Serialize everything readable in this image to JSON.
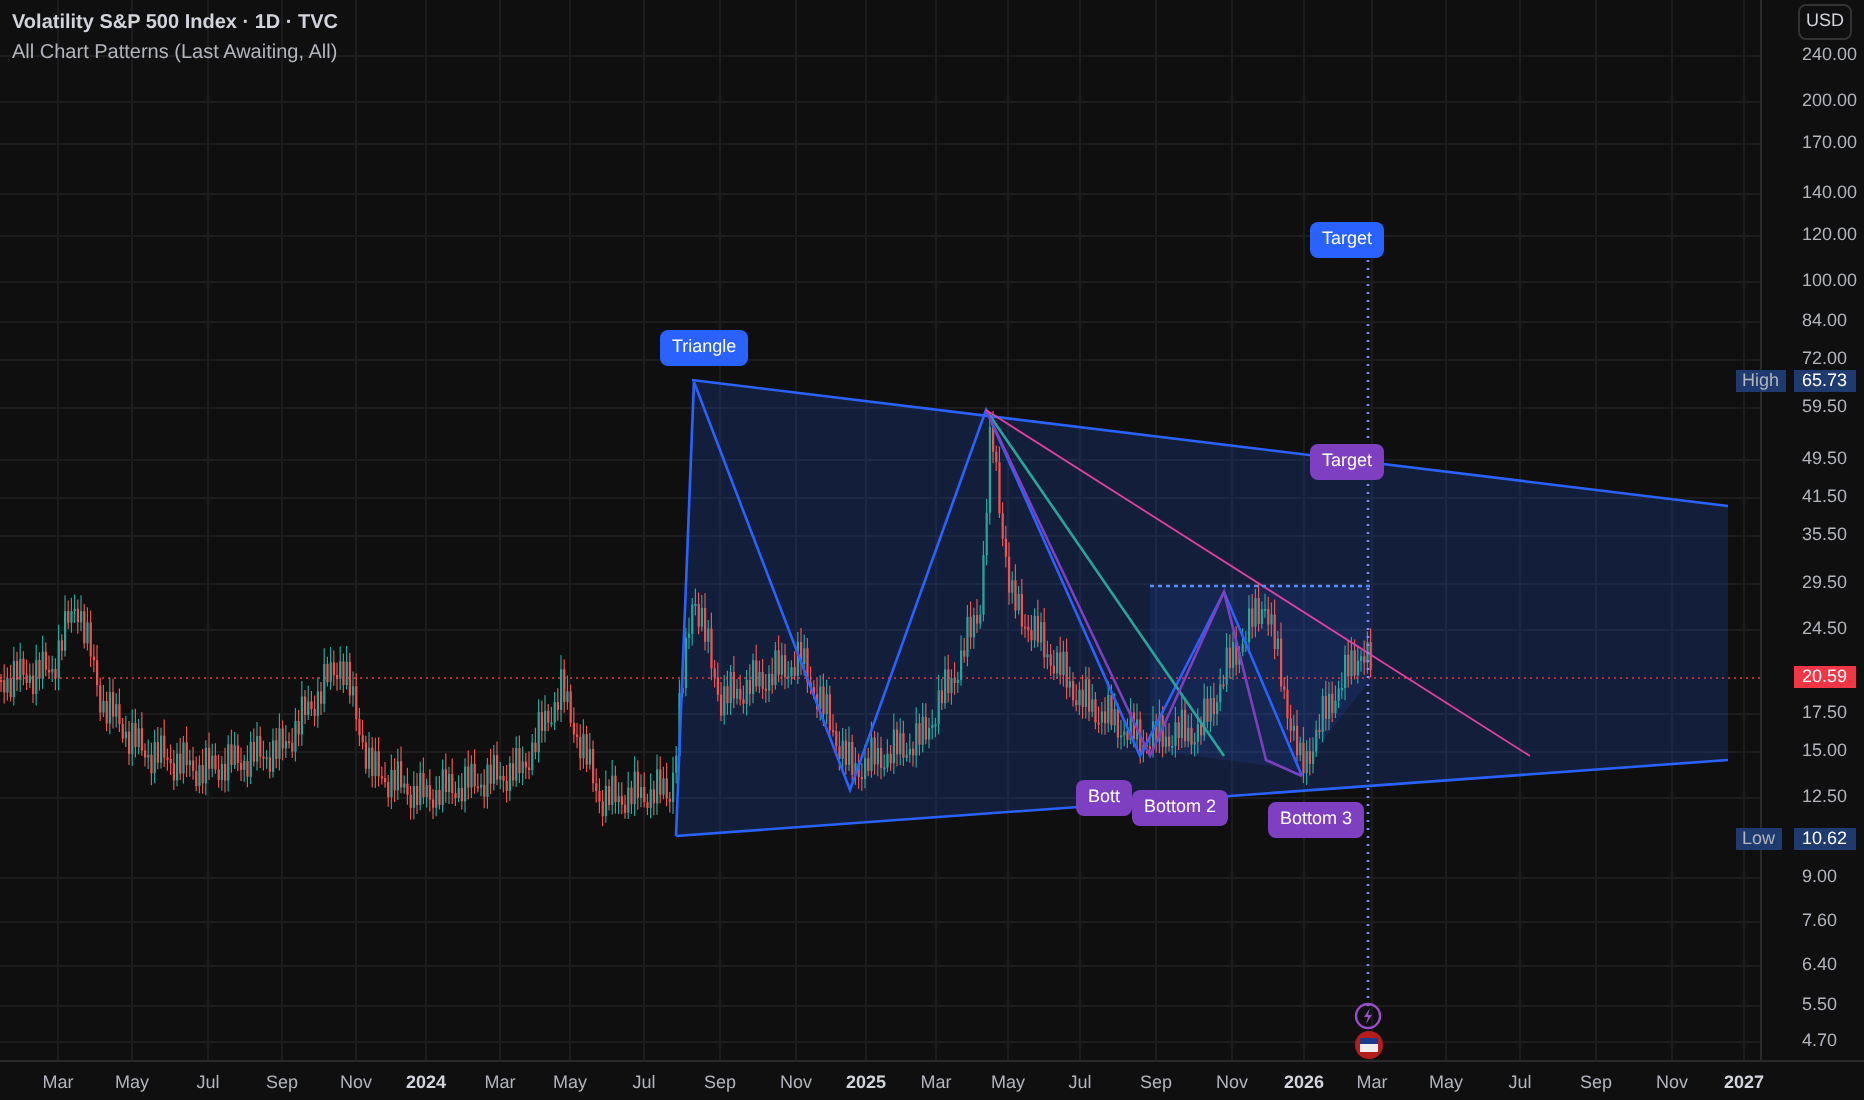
{
  "header": {
    "title": "Volatility S&P 500 Index · 1D · TVC",
    "subtitle": "All Chart Patterns (Last Awaiting, All)"
  },
  "price_axis": {
    "currency": "USD",
    "ticks": [
      "240.00",
      "200.00",
      "170.00",
      "140.00",
      "120.00",
      "100.00",
      "84.00",
      "72.00",
      "59.50",
      "49.50",
      "41.50",
      "35.50",
      "29.50",
      "24.50",
      "17.50",
      "15.00",
      "12.50",
      "9.00",
      "7.60",
      "6.40",
      "5.50",
      "4.70"
    ],
    "markers": [
      {
        "kind": "high",
        "label": "High",
        "value": "65.73"
      },
      {
        "kind": "last",
        "value": "20.59"
      },
      {
        "kind": "low",
        "label": "Low",
        "value": "10.62"
      }
    ]
  },
  "time_axis": [
    {
      "label": "Mar",
      "kind": "month"
    },
    {
      "label": "May",
      "kind": "month"
    },
    {
      "label": "Jul",
      "kind": "month"
    },
    {
      "label": "Sep",
      "kind": "month"
    },
    {
      "label": "Nov",
      "kind": "month"
    },
    {
      "label": "2024",
      "kind": "year"
    },
    {
      "label": "Mar",
      "kind": "month"
    },
    {
      "label": "May",
      "kind": "month"
    },
    {
      "label": "Jul",
      "kind": "month"
    },
    {
      "label": "Sep",
      "kind": "month"
    },
    {
      "label": "Nov",
      "kind": "month"
    },
    {
      "label": "2025",
      "kind": "year"
    },
    {
      "label": "Mar",
      "kind": "month"
    },
    {
      "label": "May",
      "kind": "month"
    },
    {
      "label": "Jul",
      "kind": "month"
    },
    {
      "label": "Sep",
      "kind": "month"
    },
    {
      "label": "Nov",
      "kind": "month"
    },
    {
      "label": "2026",
      "kind": "year"
    },
    {
      "label": "Mar",
      "kind": "month"
    },
    {
      "label": "May",
      "kind": "month"
    },
    {
      "label": "Jul",
      "kind": "month"
    },
    {
      "label": "Sep",
      "kind": "month"
    },
    {
      "label": "Nov",
      "kind": "month"
    },
    {
      "label": "2027",
      "kind": "year"
    }
  ],
  "pattern_labels": [
    {
      "text": "Triangle",
      "color": "#2962ff"
    },
    {
      "text": "Target",
      "color": "#2962ff"
    },
    {
      "text": "Target",
      "color": "#7e3fc1"
    },
    {
      "text": "Bott",
      "color": "#7e3fc1"
    },
    {
      "text": "Bottom 2",
      "color": "#7e3fc1"
    },
    {
      "text": "Bottom 3",
      "color": "#7e3fc1"
    }
  ]
}
